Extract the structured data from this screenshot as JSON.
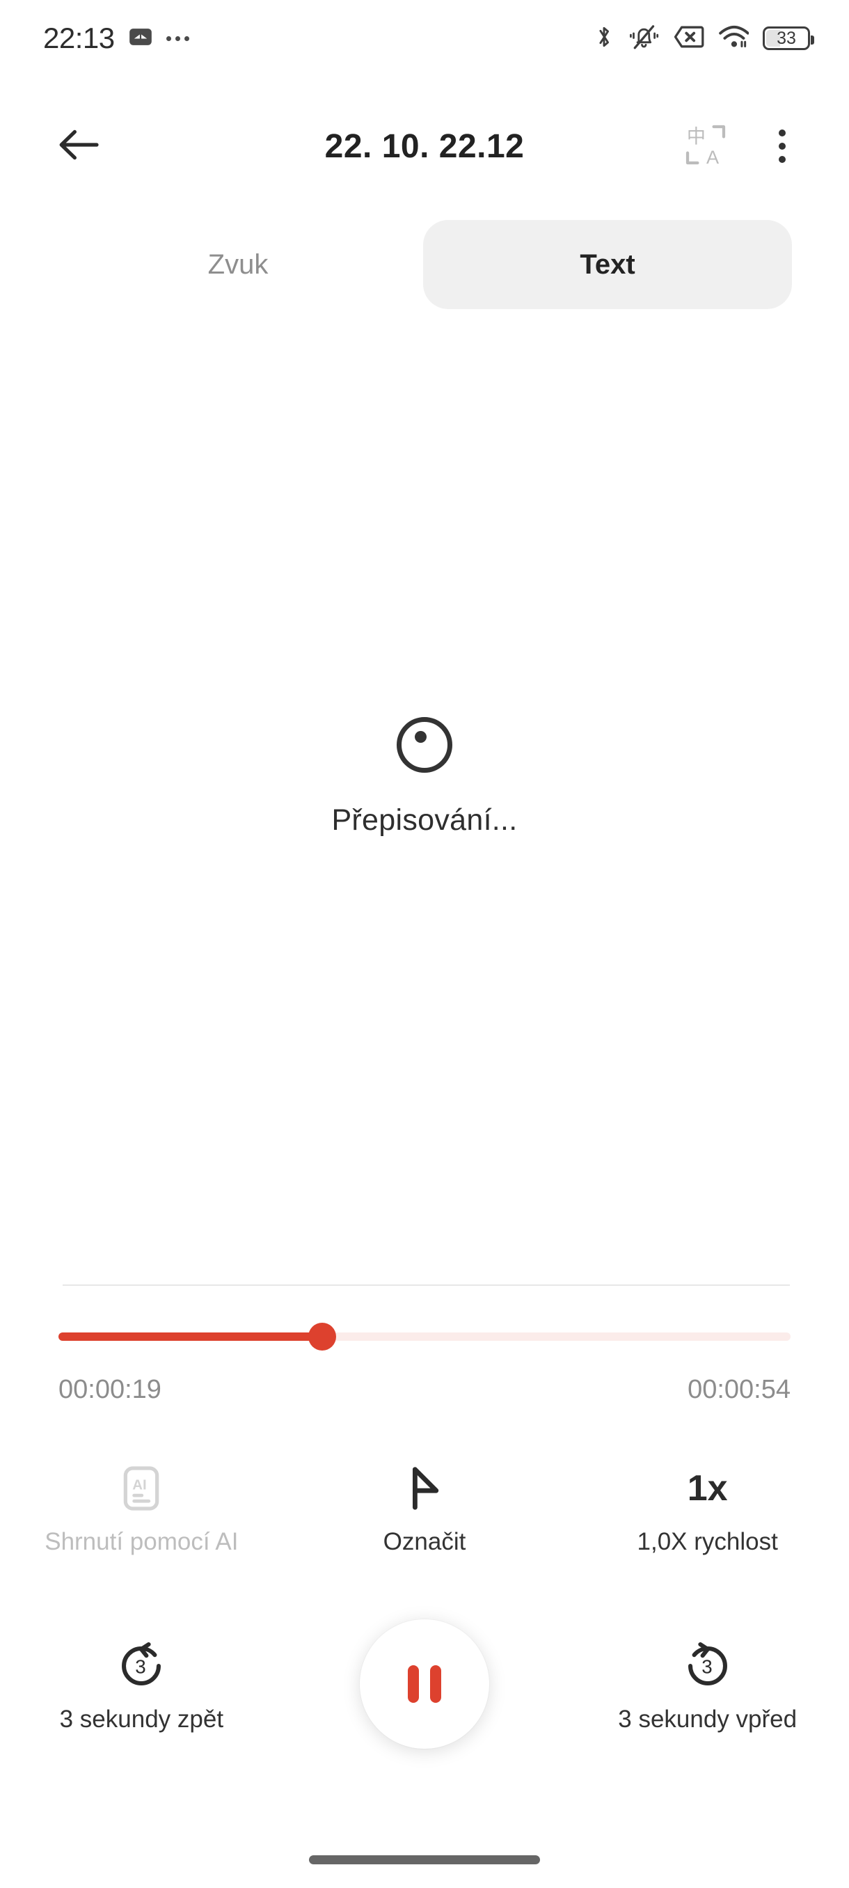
{
  "status_bar": {
    "clock": "22:13",
    "icons": [
      "phone-recorder-icon",
      "overflow-dots-icon",
      "bluetooth-icon",
      "vibrate-off-icon",
      "sim-card-missing-icon",
      "wifi-icon",
      "battery-icon"
    ],
    "battery_level": "33"
  },
  "app_bar": {
    "back_label": "back-arrow",
    "title": "22. 10. 22.12",
    "translate_icon_top_char": "中",
    "translate_icon_bottom_char": "A",
    "more_label": "more-options"
  },
  "tabs": [
    {
      "label": "Zvuk",
      "active": false
    },
    {
      "label": "Text",
      "active": true
    }
  ],
  "content": {
    "state_icon": "transcribing-spinner-icon",
    "state_label": "Přepisování..."
  },
  "player": {
    "progress_percent": 36,
    "current_time": "00:00:19",
    "total_time": "00:00:54",
    "accent_color": "#dd412e",
    "track_color": "#fbecea"
  },
  "actions_primary": [
    {
      "icon": "ai-summary-icon",
      "icon_text": "AI",
      "label": "Shrnutí pomocí AI",
      "disabled": true
    },
    {
      "icon": "flag-mark-icon",
      "icon_text": "",
      "label": "Označit",
      "disabled": false
    },
    {
      "icon": "playback-speed-icon",
      "icon_text": "1x",
      "label": "1,0X rychlost",
      "disabled": false
    }
  ],
  "actions_secondary": [
    {
      "icon": "rewind-3-seconds-icon",
      "icon_text": "3",
      "label": "3 sekundy zpět"
    },
    {
      "icon": "forward-3-seconds-icon",
      "icon_text": "3",
      "label": "3 sekundy vpřed"
    }
  ],
  "transport": {
    "pause_label": "pause-button"
  },
  "system_nav": {
    "home_indicator": "home-gesture-bar"
  }
}
